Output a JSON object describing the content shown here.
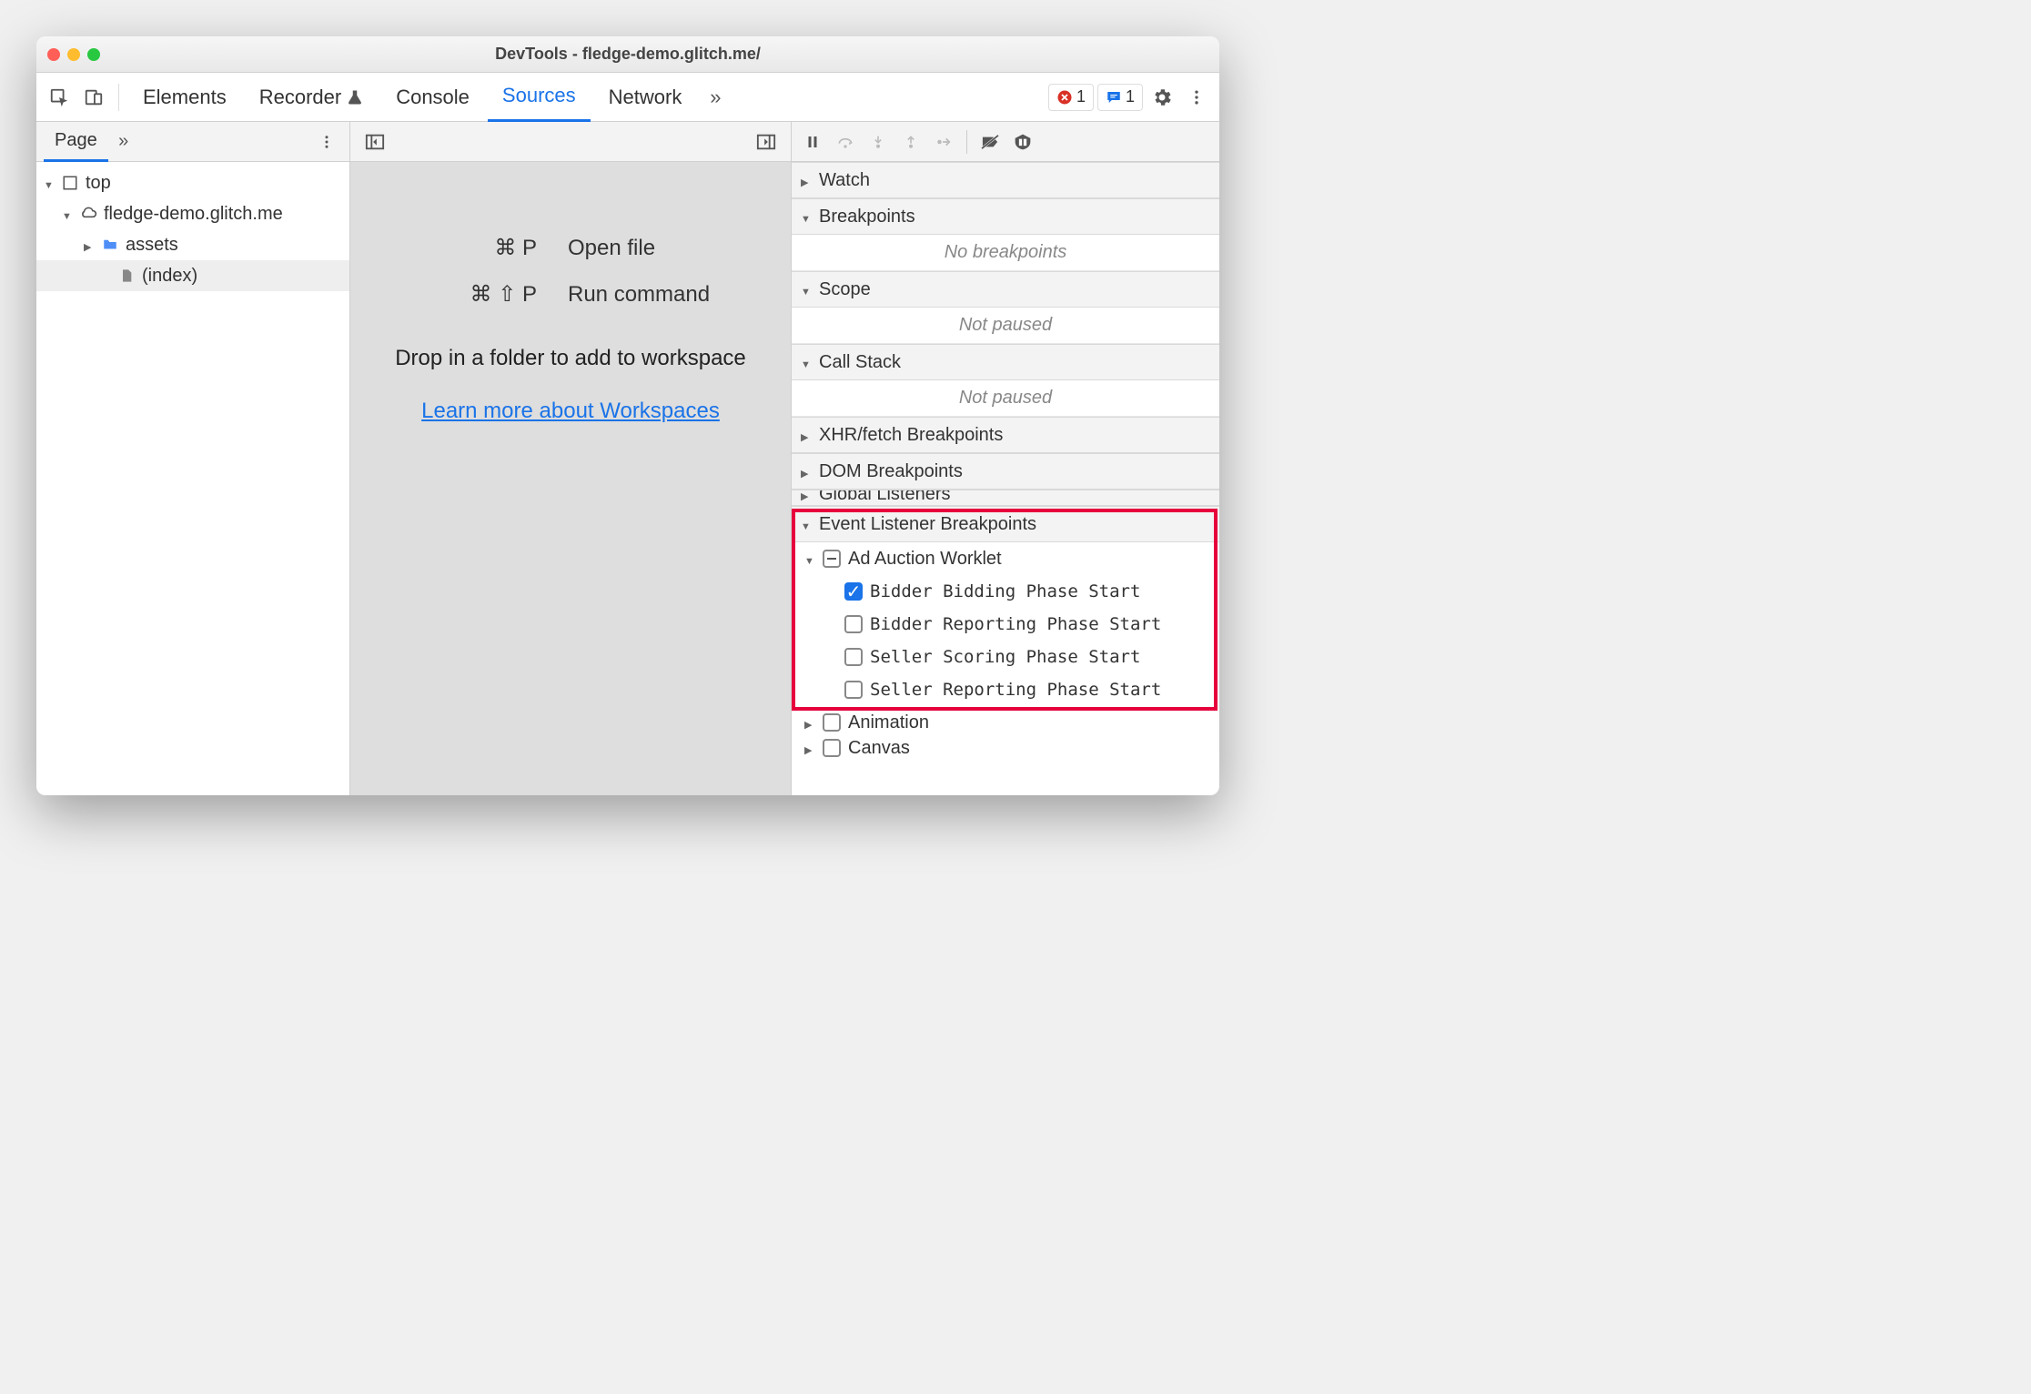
{
  "titlebar": {
    "title": "DevTools - fledge-demo.glitch.me/"
  },
  "tabs": {
    "elements": "Elements",
    "recorder": "Recorder",
    "console": "Console",
    "sources": "Sources",
    "network": "Network"
  },
  "counters": {
    "errors": "1",
    "messages": "1"
  },
  "leftpane": {
    "page_tab": "Page",
    "tree": {
      "top": "top",
      "domain": "fledge-demo.glitch.me",
      "assets": "assets",
      "index": "(index)"
    }
  },
  "midpane": {
    "openfile_keys": "⌘ P",
    "openfile_label": "Open file",
    "runcmd_keys": "⌘ ⇧ P",
    "runcmd_label": "Run command",
    "drop": "Drop in a folder to add to workspace",
    "learn": "Learn more about Workspaces"
  },
  "rightpane": {
    "watch": "Watch",
    "breakpoints": "Breakpoints",
    "no_breakpoints": "No breakpoints",
    "scope": "Scope",
    "not_paused": "Not paused",
    "callstack": "Call Stack",
    "xhr": "XHR/fetch Breakpoints",
    "dom": "DOM Breakpoints",
    "global": "Global Listeners",
    "event_listener": "Event Listener Breakpoints",
    "ad_auction": "Ad Auction Worklet",
    "items": {
      "bidder_bidding": "Bidder Bidding Phase Start",
      "bidder_reporting": "Bidder Reporting Phase Start",
      "seller_scoring": "Seller Scoring Phase Start",
      "seller_reporting": "Seller Reporting Phase Start"
    },
    "animation": "Animation",
    "canvas": "Canvas"
  }
}
